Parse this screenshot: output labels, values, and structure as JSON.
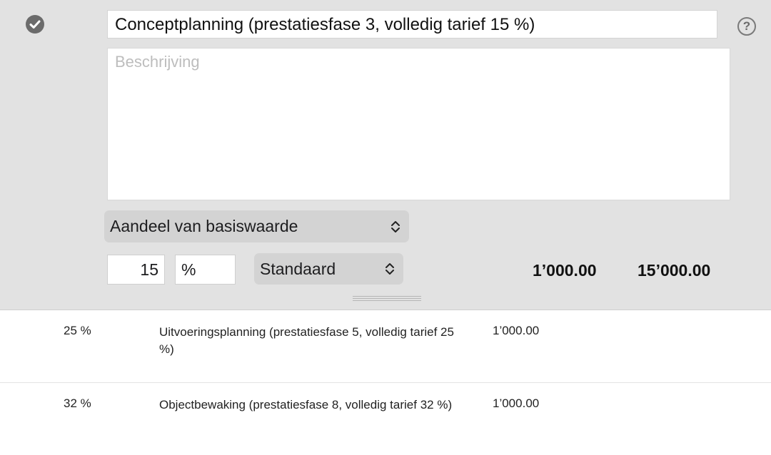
{
  "editor": {
    "title_value": "Conceptplanning (prestatiesfase 3, volledig tarief 15 %)",
    "description_placeholder": "Beschrijving",
    "basis_select": "Aandeel van basiswaarde",
    "percentage_value": "15",
    "percentage_unit": "%",
    "rate_select": "Standaard",
    "unit_price": "1’000.00",
    "total": "15’000.00"
  },
  "rows": [
    {
      "percentage": "25 %",
      "description": "Uitvoeringsplanning (prestatiesfase 5, volledig tarief 25 %)",
      "price": "1’000.00"
    },
    {
      "percentage": "32 %",
      "description": "Objectbewaking (prestatiesfase 8, volledig tarief 32 %)",
      "price": "1’000.00"
    }
  ],
  "icons": {
    "status": "checkmark-circle-icon",
    "help": "question-mark-icon",
    "select": "up-down-chevron-icon"
  },
  "colors": {
    "editor_background": "#e2e2e2",
    "select_background": "#d3d3d3",
    "check_icon": "#6b6b6b"
  }
}
